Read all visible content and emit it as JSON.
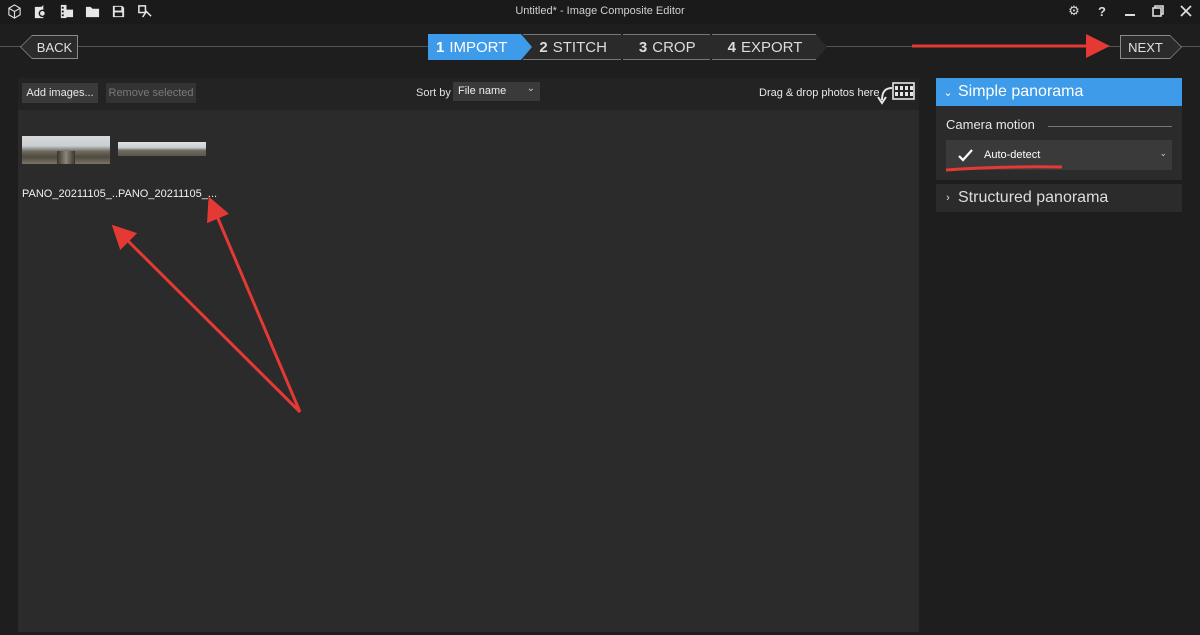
{
  "window": {
    "title": "Untitled* - Image Composite Editor",
    "toolbar_icons": [
      "cube-icon",
      "camera-icon",
      "film-icon",
      "folder-icon",
      "save-icon",
      "export-icon"
    ],
    "controls": {
      "settings": "⚙",
      "help": "?",
      "minimize": "—",
      "restore": "restore",
      "close": "✕"
    }
  },
  "nav": {
    "back_label": "BACK",
    "next_label": "NEXT",
    "steps": [
      {
        "num": "1",
        "label": "IMPORT",
        "active": true
      },
      {
        "num": "2",
        "label": "STITCH",
        "active": false
      },
      {
        "num": "3",
        "label": "CROP",
        "active": false
      },
      {
        "num": "4",
        "label": "EXPORT",
        "active": false
      }
    ]
  },
  "import_toolbar": {
    "add_label": "Add images...",
    "remove_label": "Remove selected",
    "sort_label": "Sort by",
    "sort_value": "File name",
    "drop_label": "Drag & drop photos here"
  },
  "images": [
    {
      "name": "PANO_20211105_..."
    },
    {
      "name": "PANO_20211105_..."
    }
  ],
  "right_panel": {
    "simple_title": "Simple panorama",
    "camera_motion_label": "Camera motion",
    "camera_motion_value": "Auto-detect",
    "structured_title": "Structured panorama"
  },
  "colors": {
    "accent": "#3d9be9",
    "annotation": "#e53935",
    "background": "#1e1e1e",
    "panel": "#2b2b2b"
  }
}
